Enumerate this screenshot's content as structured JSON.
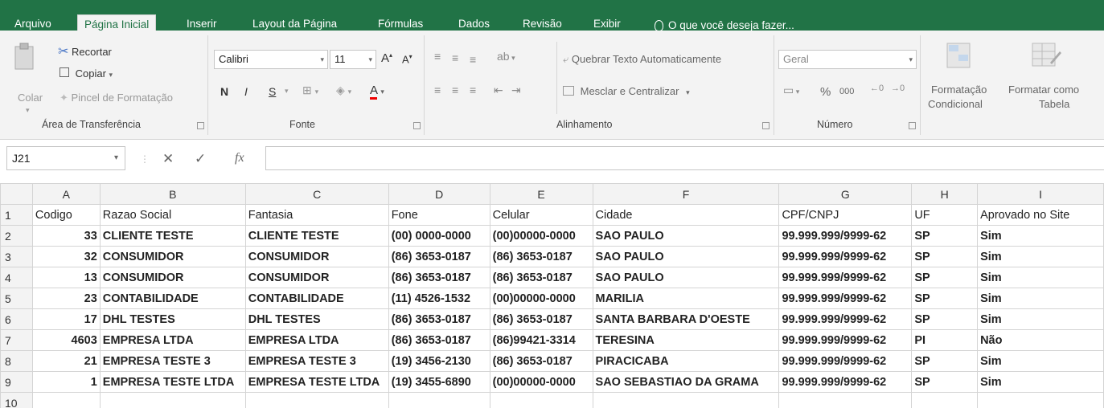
{
  "ribbon_tabs": [
    "Arquivo",
    "Página Inicial",
    "Inserir",
    "Layout da Página",
    "Fórmulas",
    "Dados",
    "Revisão",
    "Exibir"
  ],
  "tell_me": "O que você deseja fazer...",
  "clipboard": {
    "paste": "Colar",
    "cut": "Recortar",
    "copy": "Copiar",
    "format_painter": "Pincel de Formatação",
    "group": "Área de Transferência"
  },
  "font": {
    "name": "Calibri",
    "size": "11",
    "bold": "N",
    "italic": "I",
    "underline": "S",
    "group": "Fonte"
  },
  "alignment": {
    "wrap": "Quebrar Texto Automaticamente",
    "merge": "Mesclar e Centralizar",
    "group": "Alinhamento"
  },
  "number": {
    "format": "Geral",
    "percent": "%",
    "thousands": "000",
    "group": "Número"
  },
  "styles": {
    "cond_format_1": "Formatação",
    "cond_format_2": "Condicional",
    "format_table_1": "Formatar como",
    "format_table_2": "Tabela"
  },
  "formula_bar": {
    "name_box": "J21",
    "fx": "fx",
    "value": ""
  },
  "sheet": {
    "columns": [
      "A",
      "B",
      "C",
      "D",
      "E",
      "F",
      "G",
      "H",
      "I"
    ],
    "rows": [
      {
        "n": "1",
        "cells": [
          "Codigo",
          "Razao Social",
          "Fantasia",
          "Fone",
          "Celular",
          "Cidade",
          "CPF/CNPJ",
          "UF",
          "Aprovado no Site"
        ]
      },
      {
        "n": "2",
        "cells": [
          "33",
          "CLIENTE TESTE",
          "CLIENTE TESTE",
          "(00) 0000-0000",
          "(00)00000-0000",
          "SAO PAULO",
          "99.999.999/9999-62",
          "SP",
          "Sim"
        ]
      },
      {
        "n": "3",
        "cells": [
          "32",
          "CONSUMIDOR",
          "CONSUMIDOR",
          "(86) 3653-0187",
          "(86) 3653-0187",
          "SAO PAULO",
          "99.999.999/9999-62",
          "SP",
          "Sim"
        ]
      },
      {
        "n": "4",
        "cells": [
          "13",
          "CONSUMIDOR",
          "CONSUMIDOR",
          "(86) 3653-0187",
          "(86) 3653-0187",
          "SAO PAULO",
          "99.999.999/9999-62",
          "SP",
          "Sim"
        ]
      },
      {
        "n": "5",
        "cells": [
          "23",
          "CONTABILIDADE",
          "CONTABILIDADE",
          "(11) 4526-1532",
          "(00)00000-0000",
          "MARILIA",
          "99.999.999/9999-62",
          "SP",
          "Sim"
        ]
      },
      {
        "n": "6",
        "cells": [
          "17",
          "DHL TESTES",
          "DHL TESTES",
          "(86) 3653-0187",
          "(86) 3653-0187",
          "SANTA BARBARA D'OESTE",
          "99.999.999/9999-62",
          "SP",
          "Sim"
        ]
      },
      {
        "n": "7",
        "cells": [
          "4603",
          "EMPRESA LTDA",
          "EMPRESA LTDA",
          "(86) 3653-0187",
          "(86)99421-3314",
          "TERESINA",
          "99.999.999/9999-62",
          "PI",
          "Não"
        ]
      },
      {
        "n": "8",
        "cells": [
          "21",
          "EMPRESA TESTE 3",
          "EMPRESA TESTE 3",
          "(19) 3456-2130",
          "(86) 3653-0187",
          "PIRACICABA",
          "99.999.999/9999-62",
          "SP",
          "Sim"
        ]
      },
      {
        "n": "9",
        "cells": [
          "1",
          "EMPRESA TESTE LTDA",
          "EMPRESA TESTE LTDA",
          "(19) 3455-6890",
          "(00)00000-0000",
          "SAO SEBASTIAO DA GRAMA",
          "99.999.999/9999-62",
          "SP",
          "Sim"
        ]
      },
      {
        "n": "10",
        "cells": [
          "",
          "",
          "",
          "",
          "",
          "",
          "",
          "",
          ""
        ]
      }
    ]
  },
  "colors": {
    "excel_green": "#217346",
    "ribbon_bg": "#f3f3f3",
    "gridline": "#d4d4d4"
  }
}
